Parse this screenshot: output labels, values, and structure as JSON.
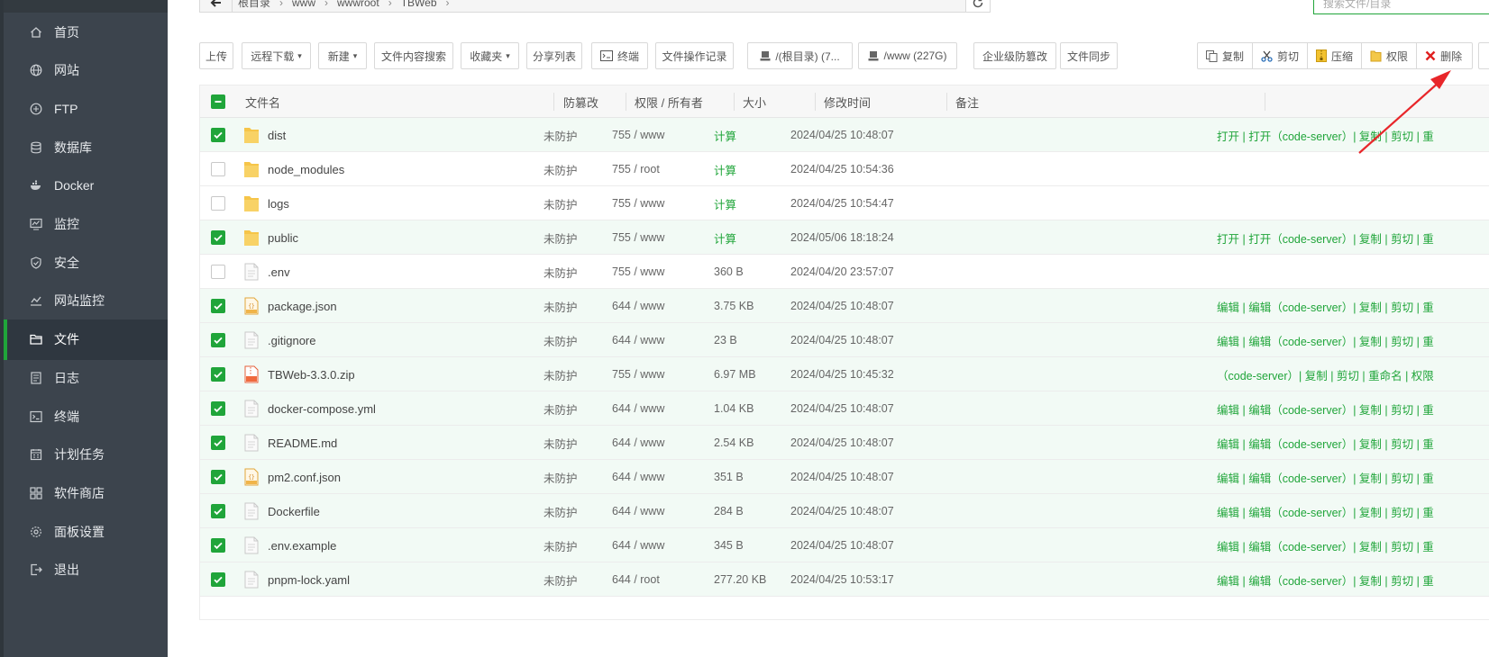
{
  "sidebar": {
    "items": [
      {
        "label": "首页",
        "icon": "home-icon"
      },
      {
        "label": "网站",
        "icon": "globe-icon"
      },
      {
        "label": "FTP",
        "icon": "ftp-icon"
      },
      {
        "label": "数据库",
        "icon": "database-icon"
      },
      {
        "label": "Docker",
        "icon": "docker-icon"
      },
      {
        "label": "监控",
        "icon": "monitor-icon"
      },
      {
        "label": "安全",
        "icon": "shield-icon"
      },
      {
        "label": "网站监控",
        "icon": "chart-icon"
      },
      {
        "label": "文件",
        "icon": "folder-icon",
        "active": true
      },
      {
        "label": "日志",
        "icon": "log-icon"
      },
      {
        "label": "终端",
        "icon": "terminal-icon"
      },
      {
        "label": "计划任务",
        "icon": "calendar-icon"
      },
      {
        "label": "软件商店",
        "icon": "apps-icon"
      },
      {
        "label": "面板设置",
        "icon": "gear-icon"
      },
      {
        "label": "退出",
        "icon": "logout-icon"
      }
    ]
  },
  "breadcrumb": {
    "items": [
      "根目录",
      "www",
      "wwwroot",
      "TBWeb"
    ]
  },
  "search": {
    "placeholder": "搜索文件/目录"
  },
  "toolbar": {
    "upload": "上传",
    "remote_download": "远程下载",
    "new": "新建",
    "content_search": "文件内容搜索",
    "favorites": "收藏夹",
    "share_list": "分享列表",
    "terminal": "终端",
    "op_log": "文件操作记录",
    "disk_root": "/(根目录) (7...",
    "disk_www": "/www (227G)",
    "tamper_proof": "企业级防篡改",
    "file_sync": "文件同步",
    "copy": "复制",
    "cut": "剪切",
    "compress": "压缩",
    "permission": "权限",
    "delete": "删除"
  },
  "table": {
    "headers": {
      "name": "文件名",
      "protect": "防篡改",
      "perm": "权限 / 所有者",
      "size": "大小",
      "mtime": "修改时间",
      "note": "备注"
    },
    "rows": [
      {
        "name": "dist",
        "type": "folder",
        "protect": "未防护",
        "perm": "755 / www",
        "size": "计算",
        "mtime": "2024/04/25 10:48:07",
        "checked": true,
        "ops": "打开 | 打开（code-server）| 复制 | 剪切 | 重"
      },
      {
        "name": "node_modules",
        "type": "folder",
        "protect": "未防护",
        "perm": "755 / root",
        "size": "计算",
        "mtime": "2024/04/25 10:54:36",
        "checked": false,
        "ops": ""
      },
      {
        "name": "logs",
        "type": "folder",
        "protect": "未防护",
        "perm": "755 / www",
        "size": "计算",
        "mtime": "2024/04/25 10:54:47",
        "checked": false,
        "ops": ""
      },
      {
        "name": "public",
        "type": "folder",
        "protect": "未防护",
        "perm": "755 / www",
        "size": "计算",
        "mtime": "2024/05/06 18:18:24",
        "checked": true,
        "ops": "打开 | 打开（code-server）| 复制 | 剪切 | 重"
      },
      {
        "name": ".env",
        "type": "file",
        "protect": "未防护",
        "perm": "755 / www",
        "size": "360 B",
        "mtime": "2024/04/20 23:57:07",
        "checked": false,
        "ops": ""
      },
      {
        "name": "package.json",
        "type": "json",
        "protect": "未防护",
        "perm": "644 / www",
        "size": "3.75 KB",
        "mtime": "2024/04/25 10:48:07",
        "checked": true,
        "ops": "编辑 | 编辑（code-server）| 复制 | 剪切 | 重"
      },
      {
        "name": ".gitignore",
        "type": "file",
        "protect": "未防护",
        "perm": "644 / www",
        "size": "23 B",
        "mtime": "2024/04/25 10:48:07",
        "checked": true,
        "ops": "编辑 | 编辑（code-server）| 复制 | 剪切 | 重"
      },
      {
        "name": "TBWeb-3.3.0.zip",
        "type": "zip",
        "protect": "未防护",
        "perm": "755 / www",
        "size": "6.97 MB",
        "mtime": "2024/04/25 10:45:32",
        "checked": true,
        "ops": "（code-server）| 复制 | 剪切 | 重命名 | 权限"
      },
      {
        "name": "docker-compose.yml",
        "type": "file",
        "protect": "未防护",
        "perm": "644 / www",
        "size": "1.04 KB",
        "mtime": "2024/04/25 10:48:07",
        "checked": true,
        "ops": "编辑 | 编辑（code-server）| 复制 | 剪切 | 重"
      },
      {
        "name": "README.md",
        "type": "file",
        "protect": "未防护",
        "perm": "644 / www",
        "size": "2.54 KB",
        "mtime": "2024/04/25 10:48:07",
        "checked": true,
        "ops": "编辑 | 编辑（code-server）| 复制 | 剪切 | 重"
      },
      {
        "name": "pm2.conf.json",
        "type": "json",
        "protect": "未防护",
        "perm": "644 / www",
        "size": "351 B",
        "mtime": "2024/04/25 10:48:07",
        "checked": true,
        "ops": "编辑 | 编辑（code-server）| 复制 | 剪切 | 重"
      },
      {
        "name": "Dockerfile",
        "type": "file",
        "protect": "未防护",
        "perm": "644 / www",
        "size": "284 B",
        "mtime": "2024/04/25 10:48:07",
        "checked": true,
        "ops": "编辑 | 编辑（code-server）| 复制 | 剪切 | 重"
      },
      {
        "name": ".env.example",
        "type": "file",
        "protect": "未防护",
        "perm": "644 / www",
        "size": "345 B",
        "mtime": "2024/04/25 10:48:07",
        "checked": true,
        "ops": "编辑 | 编辑（code-server）| 复制 | 剪切 | 重"
      },
      {
        "name": "pnpm-lock.yaml",
        "type": "file",
        "protect": "未防护",
        "perm": "644 / root",
        "size": "277.20 KB",
        "mtime": "2024/04/25 10:53:17",
        "checked": true,
        "ops": "编辑 | 编辑（code-server）| 复制 | 剪切 | 重"
      }
    ]
  },
  "colors": {
    "accent": "#20a53a",
    "sidebar_bg": "#3c444d",
    "delete_red": "#e02020",
    "annotation_arrow": "#e8262a"
  }
}
